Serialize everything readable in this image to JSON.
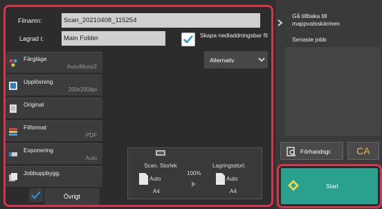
{
  "form": {
    "filename_label": "Filnamn:",
    "filename_value": "Scan_20210408_115254",
    "save_label": "Lagrad i:",
    "save_value": "Main Folder",
    "create_link_label": "Skapa nedladdningsbar fil",
    "create_link_checked": true,
    "alternatives_label": "Alternativ"
  },
  "settings": [
    {
      "label": "Färgläge",
      "value": "Auto/Mono2"
    },
    {
      "label": "Upplösning",
      "value": "200x200dpi"
    },
    {
      "label": "Original",
      "value": ""
    },
    {
      "label": "Filformat",
      "value": "PDF"
    },
    {
      "label": "Exponering",
      "value": "Auto"
    },
    {
      "label": "Jobbuppbygg.",
      "value": ""
    }
  ],
  "scan_preview": {
    "scan_size_label": "Scan. Storlek",
    "scan_size_auto": "Auto",
    "scan_size_paper": "A4",
    "ratio": "100%",
    "store_size_label": "Lagringsstorl.",
    "store_size_auto": "Auto",
    "store_size_paper": "A4"
  },
  "bottom": {
    "other_label": "Övrigt"
  },
  "right": {
    "back_label": "Gå tillbaka till mappvalsskärmen",
    "recent_label": "Senaste jobb",
    "preview_label": "Förhandsgr.",
    "ca_label": "CA",
    "start_label": "Start"
  },
  "colors": {
    "highlight": "#d9344a",
    "start": "#2aa08f",
    "check": "#2b8fd8",
    "ca": "#e6b84a"
  }
}
